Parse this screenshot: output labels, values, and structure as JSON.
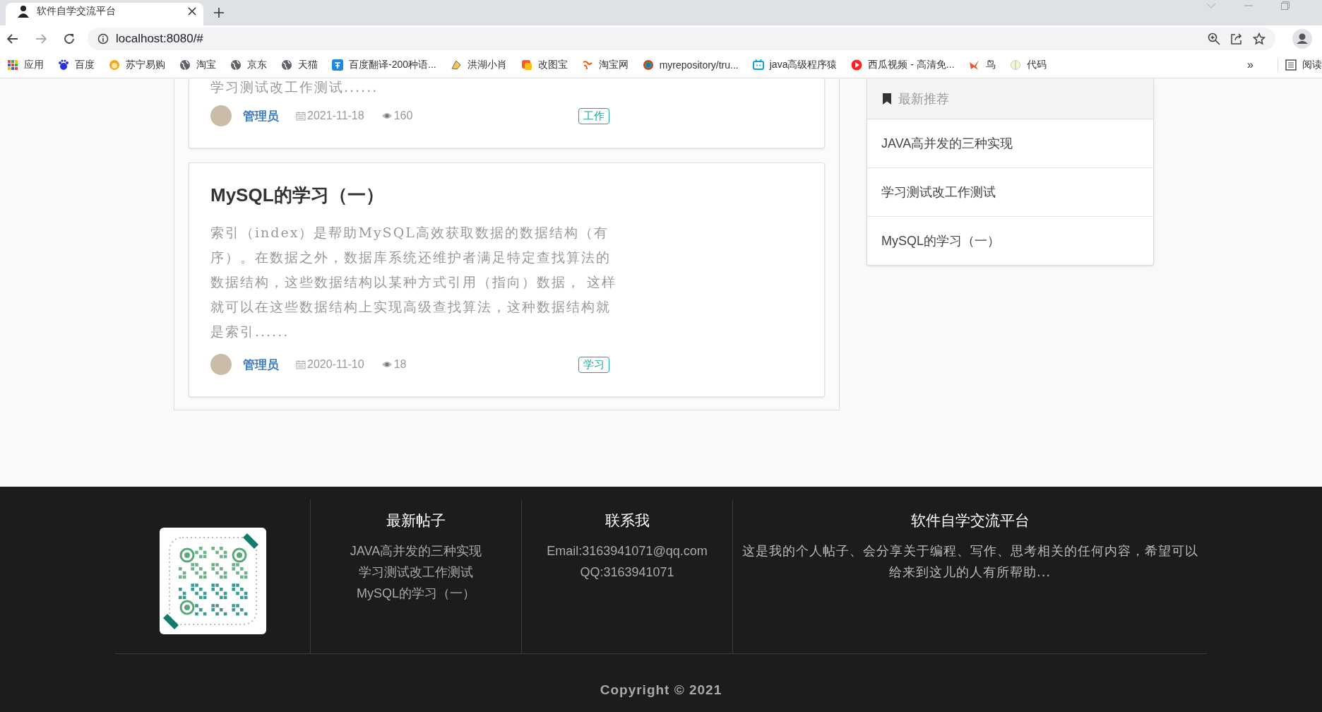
{
  "browser": {
    "tab": {
      "title": "软件自学交流平台",
      "selected": true
    },
    "address": "localhost:8080/#",
    "bookmarks": [
      {
        "label": "应用"
      },
      {
        "label": "百度"
      },
      {
        "label": "苏宁易购"
      },
      {
        "label": "淘宝"
      },
      {
        "label": "京东"
      },
      {
        "label": "天猫"
      },
      {
        "label": "百度翻译-200种语..."
      },
      {
        "label": "洪湖小肖"
      },
      {
        "label": "改图宝"
      },
      {
        "label": "淘宝网"
      },
      {
        "label": "myrepository/tru..."
      },
      {
        "label": "java高级程序猿"
      },
      {
        "label": "西瓜视频 - 高清免..."
      },
      {
        "label": "鸟"
      },
      {
        "label": "代码"
      }
    ],
    "overflow": "»",
    "reading_list": "阅读"
  },
  "posts": [
    {
      "excerpt": "学习测试改工作测试......",
      "author": "管理员",
      "date": "2021-11-18",
      "views": "160",
      "tag": "工作"
    },
    {
      "title": "MySQL的学习（一）",
      "excerpt": "索引（index）是帮助MySQL高效获取数据的数据结构（有序）。在数据之外，数据库系统还维护者满足特定查找算法的数据结构，这些数据结构以某种方式引用（指向）数据， 这样就可以在这些数据结构上实现高级查找算法，这种数据结构就是索引......",
      "author": "管理员",
      "date": "2020-11-10",
      "views": "18",
      "tag": "学习"
    }
  ],
  "sidebar": {
    "title": "最新推荐",
    "items": [
      "JAVA高并发的三种实现",
      "学习测试改工作测试",
      "MySQL的学习（一）"
    ]
  },
  "footer": {
    "latest": {
      "title": "最新帖子",
      "items": [
        "JAVA高并发的三种实现",
        "学习测试改工作测试",
        "MySQL的学习（一）"
      ]
    },
    "contact": {
      "title": "联系我",
      "items": [
        "Email:3163941071@qq.com",
        "QQ:3163941071"
      ]
    },
    "about": {
      "title": "软件自学交流平台",
      "text": "这是我的个人帖子、会分享关于编程、写作、思考相关的任何内容，希望可以给来到这儿的人有所帮助..."
    },
    "copyright": "Copyright © 2021"
  }
}
